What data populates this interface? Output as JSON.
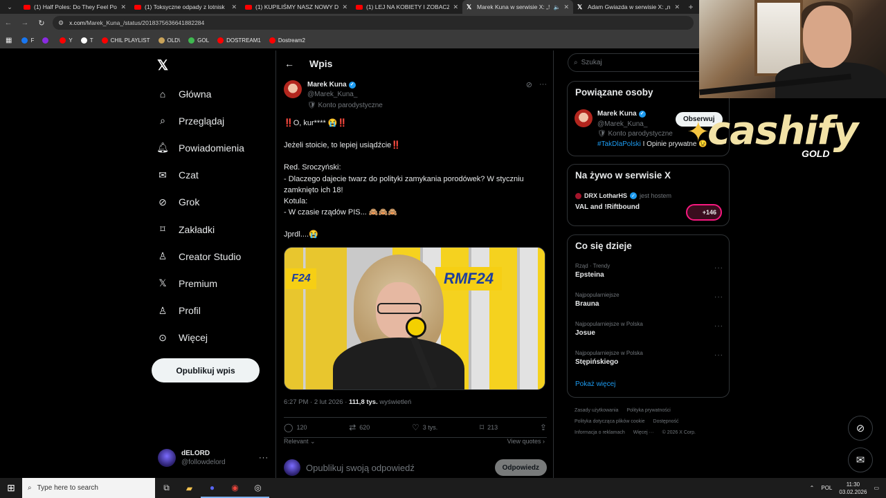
{
  "browser": {
    "tabs": [
      {
        "title": "(1) Half Poles: Do They Feel Pol",
        "favicon": "youtube-icon",
        "active": false
      },
      {
        "title": "(1) Toksyczne odpady z lotnisk",
        "favicon": "youtube-icon",
        "active": false
      },
      {
        "title": "(1) KUPILIŚMY NASZ NOWY DO",
        "favicon": "youtube-icon",
        "active": false
      },
      {
        "title": "(1) LEJ NA KOBIETY I ZOBACZY",
        "favicon": "youtube-icon",
        "active": false
      },
      {
        "title": "Marek Kuna w serwisie X: „‼",
        "favicon": "x-icon",
        "active": true
      },
      {
        "title": "Adam Gwiazda w serwisie X: „n",
        "favicon": "x-icon",
        "active": false
      }
    ],
    "url_host": "x.com",
    "url_path": "/Marek_Kuna_/status/2018375636641882284",
    "bookmarks": [
      {
        "label": "F",
        "color": "#1877f2"
      },
      {
        "label": "",
        "color": "#8a2be2"
      },
      {
        "label": "Y",
        "color": "#ff0000"
      },
      {
        "label": "T",
        "color": "#ffffff"
      },
      {
        "label": "CHIL PLAYLIST",
        "color": "#ff0000"
      },
      {
        "label": "OLD\\",
        "color": "#c9a35a"
      },
      {
        "label": "GOL",
        "color": "#3fb950"
      },
      {
        "label": "DOSTREAM1",
        "color": "#ff0000"
      },
      {
        "label": "Dostream2",
        "color": "#ff0000"
      }
    ]
  },
  "sidebar": {
    "items": [
      {
        "label": "Główna",
        "icon": "home-icon"
      },
      {
        "label": "Przeglądaj",
        "icon": "search-icon"
      },
      {
        "label": "Powiadomienia",
        "icon": "bell-icon"
      },
      {
        "label": "Czat",
        "icon": "mail-icon"
      },
      {
        "label": "Grok",
        "icon": "grok-icon"
      },
      {
        "label": "Zakładki",
        "icon": "bookmark-icon"
      },
      {
        "label": "Creator Studio",
        "icon": "creator-icon"
      },
      {
        "label": "Premium",
        "icon": "x-icon"
      },
      {
        "label": "Profil",
        "icon": "person-icon"
      },
      {
        "label": "Więcej",
        "icon": "more-circle-icon"
      }
    ],
    "post_button": "Opublikuj wpis",
    "user": {
      "name": "dELORD",
      "handle": "@followdelord"
    }
  },
  "main": {
    "header_title": "Wpis",
    "author": {
      "name": "Marek Kuna",
      "handle": "@Marek_Kuna_",
      "label": "Konto parodystyczne"
    },
    "tweet": {
      "line1": "‼️O, kur**** 😭‼️",
      "line2": "Jeżeli stoicie, to lepiej usiądźcie‼️",
      "line3": "Red. Sroczyński:\n- Dlaczego dajecie twarz do polityki zamykania porodówek? W styczniu zamknięto ich 18!\nKotula:\n- W czasie rządów PIS... 🙈🙈🙈",
      "line4": "Jprdl....😭"
    },
    "media_logo": "RMF24",
    "media_logo_left": "F24",
    "meta": {
      "time": "6:27 PM · 2 lut 2026 · ",
      "views": "111,8 tys.",
      "views_label": " wyświetleń"
    },
    "actions": {
      "replies": "120",
      "reposts": "620",
      "likes": "3 tys.",
      "bookmarks": "213"
    },
    "relevant": "Relevant",
    "view_quotes": "View quotes",
    "reply_placeholder": "Opublikuj swoją odpowiedź",
    "reply_button": "Odpowiedz"
  },
  "right": {
    "search_placeholder": "Szukaj",
    "related": {
      "title": "Powiązane osoby",
      "name": "Marek Kuna",
      "handle": "@Marek_Kuna_",
      "follow": "Obserwuj",
      "label": "Konto parodystyczne",
      "hashtag": "#TakDlaPolski",
      "bio_rest": " I Opinie prywatne 😉"
    },
    "live": {
      "title": "Na żywo w serwisie X",
      "host": "DRX LotharHS",
      "host_suffix": "jest hostem",
      "stream": "VAL and !Riftbound",
      "listeners": "+146"
    },
    "trends": {
      "title": "Co się dzieje",
      "items": [
        {
          "category": "Rząd · Trendy",
          "topic": "Epsteina"
        },
        {
          "category": "Najpopularniejsze",
          "topic": "Brauna"
        },
        {
          "category": "Najpopularniejsze w Polska",
          "topic": "Josue"
        },
        {
          "category": "Najpopularniejsze w Polska",
          "topic": "Stępińskiego"
        }
      ],
      "show_more": "Pokaż więcej"
    },
    "footer": {
      "l1": "Zasady użytkowania",
      "l2": "Polityka prywatności",
      "l3": "Polityka dotycząca plików cookie",
      "l4": "Dostępność",
      "l5": "Informacja o reklamach",
      "l6": "Więcej ···",
      "l7": "© 2026 X Corp."
    }
  },
  "overlay": {
    "brand": "cashify",
    "brand_sub": "GOLD"
  },
  "taskbar": {
    "search_placeholder": "Type here to search",
    "lang": "POL",
    "time": "11:30",
    "date": "03.02.2026"
  },
  "colors": {
    "accent": "#1d9bf0",
    "background": "#000000",
    "border": "#2f3336",
    "muted": "#71767b"
  }
}
